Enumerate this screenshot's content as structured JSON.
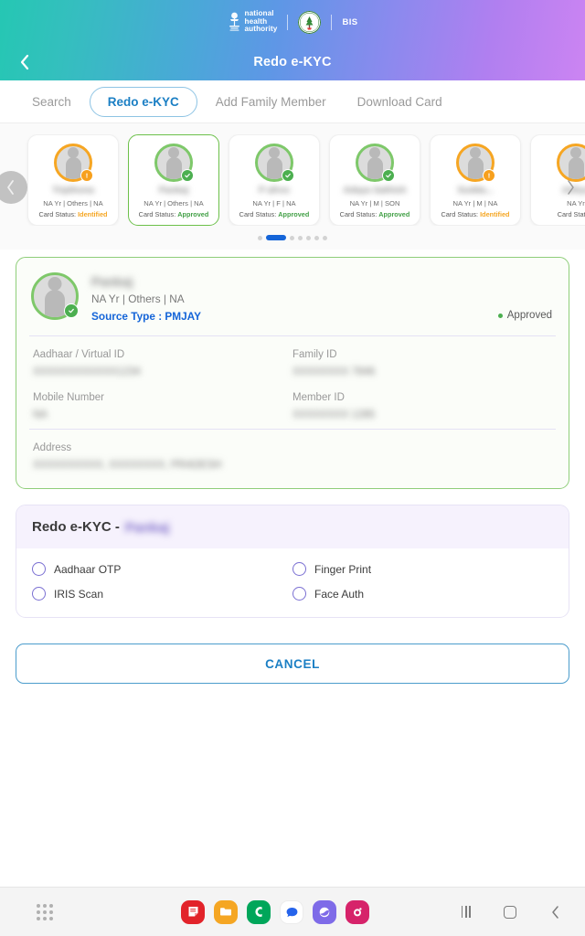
{
  "header": {
    "brand": {
      "nha_line1": "national",
      "nha_line2": "health",
      "nha_line3": "authority",
      "state_seal_name": "state-government-seal",
      "bis_label": "BIS"
    },
    "back_icon": "chevron-left-icon",
    "title": "Redo e-KYC"
  },
  "tabs": [
    {
      "label": "Search",
      "active": false
    },
    {
      "label": "Redo e-KYC",
      "active": true
    },
    {
      "label": "Add Family Member",
      "active": false
    },
    {
      "label": "Download Card",
      "active": false
    }
  ],
  "carousel": {
    "prev_icon": "chevron-left-icon",
    "next_icon": "chevron-right-icon",
    "status_label": "Card Status:",
    "cards": [
      {
        "name": "Tripthona",
        "meta": "NA Yr | Others | NA",
        "status": "Identified",
        "status_kind": "identified",
        "selected": false
      },
      {
        "name": "Pankaj",
        "meta": "NA Yr | Others | NA",
        "status": "Approved",
        "status_kind": "approved",
        "selected": true
      },
      {
        "name": "P afros",
        "meta": "NA Yr | F | NA",
        "status": "Approved",
        "status_kind": "approved",
        "selected": false
      },
      {
        "name": "Adaya Sathish",
        "meta": "NA Yr | M | SON",
        "status": "Approved",
        "status_kind": "approved",
        "selected": false
      },
      {
        "name": "Sudda...",
        "meta": "NA Yr | M | NA",
        "status": "Identified",
        "status_kind": "identified",
        "selected": false
      },
      {
        "name": "Aditya",
        "meta": "NA Yr",
        "status": "",
        "status_kind": "approved",
        "selected": false
      }
    ],
    "dots": {
      "total": 7,
      "active_index": 1
    }
  },
  "detail": {
    "name": "Pankaj",
    "meta": "NA Yr | Others | NA",
    "source_type": "Source Type : PMJAY",
    "status": "Approved",
    "fields": [
      {
        "label": "Aadhaar / Virtual ID",
        "value": "XXXXXXXXXXXX1234"
      },
      {
        "label": "Family ID",
        "value": "XXXXXXXX 7846"
      },
      {
        "label": "Mobile Number",
        "value": "NA"
      },
      {
        "label": "Member ID",
        "value": "XXXXXXXX 1285"
      }
    ],
    "address_label": "Address",
    "address_value": "XXXXXXXXXX, XXXXXXXX, PRADESH"
  },
  "redo_panel": {
    "title_prefix": "Redo e-KYC -",
    "title_name": "Pankaj",
    "options": [
      {
        "label": "Aadhaar OTP",
        "selected": false
      },
      {
        "label": "Finger Print",
        "selected": false
      },
      {
        "label": "IRIS Scan",
        "selected": false
      },
      {
        "label": "Face Auth",
        "selected": false
      }
    ]
  },
  "cancel_button": {
    "label": "CANCEL"
  },
  "system_bar": {
    "apps_icon": "app-grid-icon",
    "dock": [
      {
        "name": "samsung-notes-icon",
        "color": "#E2232A",
        "glyph": "note"
      },
      {
        "name": "my-files-icon",
        "color": "#F5A623",
        "glyph": "folder"
      },
      {
        "name": "phone-icon",
        "color": "#00A65A",
        "glyph": "phone"
      },
      {
        "name": "messages-icon",
        "color": "#FFFFFF",
        "glyph": "bubble"
      },
      {
        "name": "samsung-internet-icon",
        "color": "#7E6BE8",
        "glyph": "globe"
      },
      {
        "name": "instagram-icon",
        "color": "#D6236A",
        "glyph": "camera"
      }
    ],
    "nav": {
      "recents_icon": "recents-icon",
      "home_icon": "home-icon",
      "back_icon": "back-icon"
    }
  },
  "colors": {
    "gradient_start": "#25C7B3",
    "gradient_mid": "#5E97E6",
    "gradient_end": "#CC84F2",
    "accent_blue": "#1B7FC4",
    "approved_green": "#43A047",
    "identified_amber": "#F5A623",
    "radio_purple": "#7A6FD2"
  }
}
